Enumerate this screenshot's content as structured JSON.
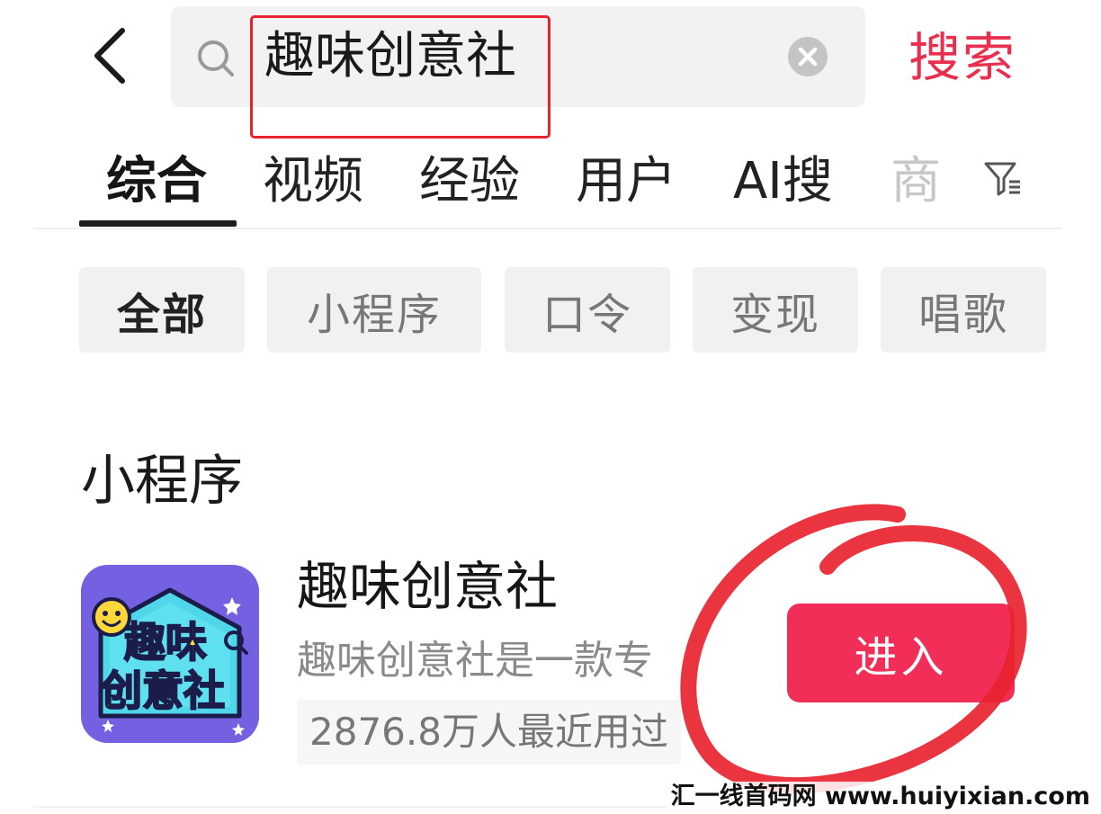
{
  "search": {
    "query": "趣味创意社",
    "submit_label": "搜索"
  },
  "tabs": [
    {
      "label": "综合"
    },
    {
      "label": "视频"
    },
    {
      "label": "经验"
    },
    {
      "label": "用户"
    },
    {
      "label": "AI搜"
    },
    {
      "label": "商"
    }
  ],
  "chips": [
    {
      "label": "全部"
    },
    {
      "label": "小程序"
    },
    {
      "label": "口令"
    },
    {
      "label": "变现"
    },
    {
      "label": "唱歌"
    }
  ],
  "section": {
    "title": "小程序"
  },
  "result": {
    "name": "趣味创意社",
    "description": "趣味创意社是一款专",
    "usage": "2876.8万人最近用过",
    "enter_label": "进入",
    "icon_text_line1": "趣味",
    "icon_text_line2": "创意社"
  },
  "icons": {
    "back": "chevron-left-icon",
    "search": "search-icon",
    "clear": "clear-circle-icon",
    "filter": "filter-icon"
  },
  "colors": {
    "accent": "#f02e57",
    "search_label": "#e8304e",
    "highlight_annotation": "#e8232f"
  },
  "watermark": "汇一线首码网 www.huiyixian.com"
}
